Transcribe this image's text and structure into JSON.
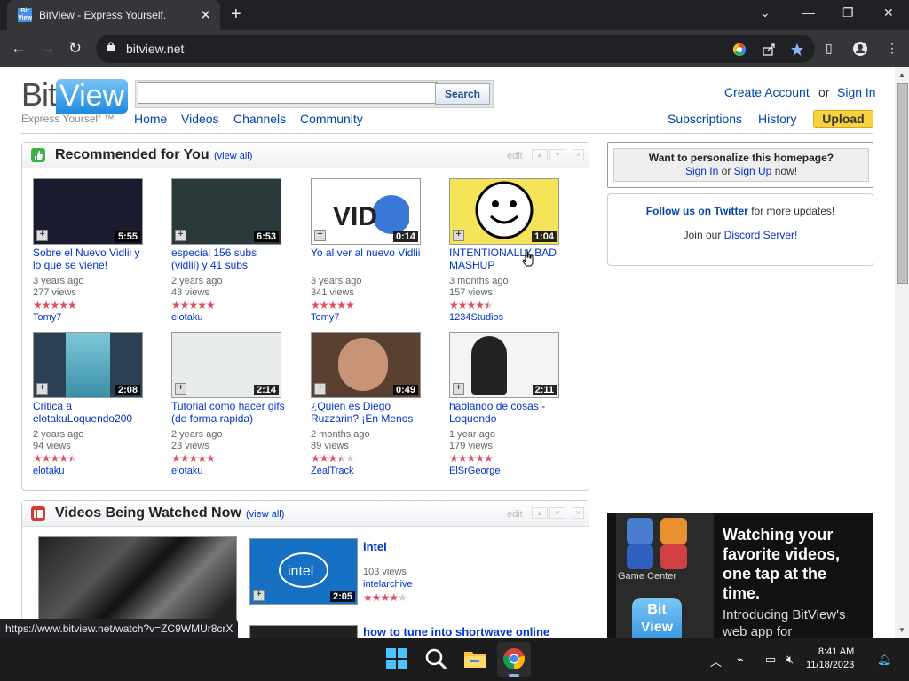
{
  "browser": {
    "tab_title": "BitView - Express Yourself.",
    "favicon_text": "Bit View",
    "url": "bitview.net",
    "status_url": "https://www.bitview.net/watch?v=ZC9WMUr8crX"
  },
  "header": {
    "logo_bit": "Bit",
    "logo_view": "View",
    "tagline": "Express Yourself ™",
    "search_placeholder": "",
    "search_button": "Search",
    "nav": [
      "Home",
      "Videos",
      "Channels",
      "Community"
    ],
    "create_account": "Create Account",
    "or": "or",
    "sign_in": "Sign In",
    "subscriptions": "Subscriptions",
    "history": "History",
    "upload": "Upload"
  },
  "recommended": {
    "title": "Recommended for You",
    "view_all": "(view all)",
    "edit": "edit",
    "videos": [
      {
        "title": "Sobre el Nuevo Vidlii y lo que se viene!",
        "duration": "5:55",
        "age": "3 years ago",
        "views": "277 views",
        "user": "Tomy7",
        "rating": 5,
        "thumb": "#1b1b2f"
      },
      {
        "title": "especial 156 subs (vidlii) y 41 subs",
        "duration": "6:53",
        "age": "2 years ago",
        "views": "43 views",
        "user": "elotaku",
        "rating": 5,
        "thumb": "#2a3a3a"
      },
      {
        "title": "Yo al ver al nuevo Vidlii",
        "duration": "0:14",
        "age": "3 years ago",
        "views": "341 views",
        "user": "Tomy7",
        "rating": 5,
        "thumb": "#ffffff"
      },
      {
        "title": "INTENTIONALLY BAD MASHUP",
        "duration": "1:04",
        "age": "3 months ago",
        "views": "157 views",
        "user": "1234Studios",
        "rating": 4.5,
        "thumb": "#f5e45a"
      },
      {
        "title": "Critica a elotakuLoquendo200",
        "duration": "2:08",
        "age": "2 years ago",
        "views": "94 views",
        "user": "elotaku",
        "rating": 4.5,
        "thumb": "#2b3f55"
      },
      {
        "title": "Tutorial como hacer gifs (de forma rapida)",
        "duration": "2:14",
        "age": "2 years ago",
        "views": "23 views",
        "user": "elotaku",
        "rating": 5,
        "thumb": "#e8ece8"
      },
      {
        "title": "¿Quien es Diego Ruzzarin? ¡En Menos",
        "duration": "0:49",
        "age": "2 months ago",
        "views": "89 views",
        "user": "ZealTrack",
        "rating": 3.5,
        "thumb": "#5a4030"
      },
      {
        "title": "hablando de cosas - Loquendo",
        "duration": "2:11",
        "age": "1 year ago",
        "views": "179 views",
        "user": "ElSrGeorge",
        "rating": 5,
        "thumb": "#f4f4f4"
      }
    ]
  },
  "watching": {
    "title": "Videos Being Watched Now",
    "view_all": "(view all)",
    "edit": "edit",
    "videos": [
      {
        "title": "intel",
        "views": "103 views",
        "user": "intelarchive",
        "duration": "2:05",
        "rating": 4
      },
      {
        "title": "how to tune into shortwave online"
      }
    ]
  },
  "sidebar": {
    "personalize": "Want to personalize this homepage?",
    "sign_in": "Sign In",
    "or": "or",
    "sign_up": "Sign Up",
    "now": "now!",
    "follow_link": "Follow us on Twitter",
    "follow_rest": "for more updates!",
    "discord_pre": "Join our",
    "discord_link": "Discord Server!",
    "ad_headline": "Watching your favorite videos, one tap at the time.",
    "ad_sub": "Introducing BitView's web app for",
    "ad_game_center": "Game Center",
    "ad_logo_text": "Bit View"
  },
  "taskbar": {
    "time": "8:41 AM",
    "date": "11/18/2023"
  }
}
